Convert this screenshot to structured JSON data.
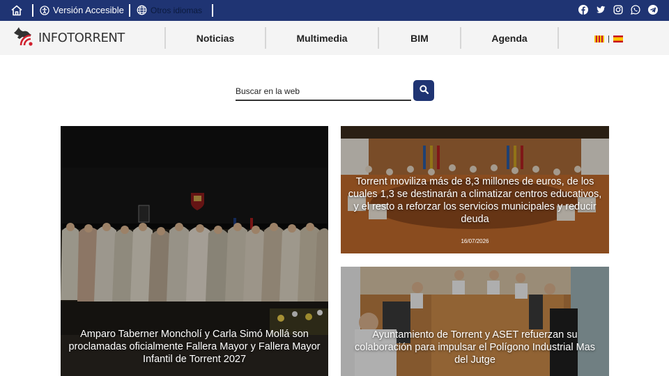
{
  "topbar": {
    "accessible_label": "Versión Accesible",
    "languages_label": "Otros idiomas",
    "social": [
      "facebook-icon",
      "twitter-icon",
      "instagram-icon",
      "whatsapp-icon",
      "telegram-icon"
    ]
  },
  "brand": {
    "name": "INFOTORRENT"
  },
  "nav": {
    "items": [
      {
        "label": "Noticias"
      },
      {
        "label": "Multimedia"
      },
      {
        "label": "BIM"
      },
      {
        "label": "Agenda"
      }
    ],
    "lang_separator": "|"
  },
  "search": {
    "placeholder": "Buscar en la web"
  },
  "news": {
    "main": {
      "title": "Amparo Taberner Moncholí y Carla Simó Mollá son proclamadas oficialmente Fallera Mayor y Fallera Mayor Infantil de Torrent 2027"
    },
    "secondary": [
      {
        "title": "Torrent moviliza más de 8,3 millones de euros, de los cuales 1,3 se destinarán a climatizar centros educativos, y el resto a reforzar los servicios municipales y reducir deuda",
        "date": "16/07/2026"
      },
      {
        "title": "Ayuntamiento de Torrent y ASET refuerzan su colaboración para impulsar el Polígono Industrial Mas del Jutge"
      }
    ]
  },
  "colors": {
    "primary": "#1f3473",
    "nav_bg": "#f4f4f4",
    "logo_red": "#d0202e"
  }
}
